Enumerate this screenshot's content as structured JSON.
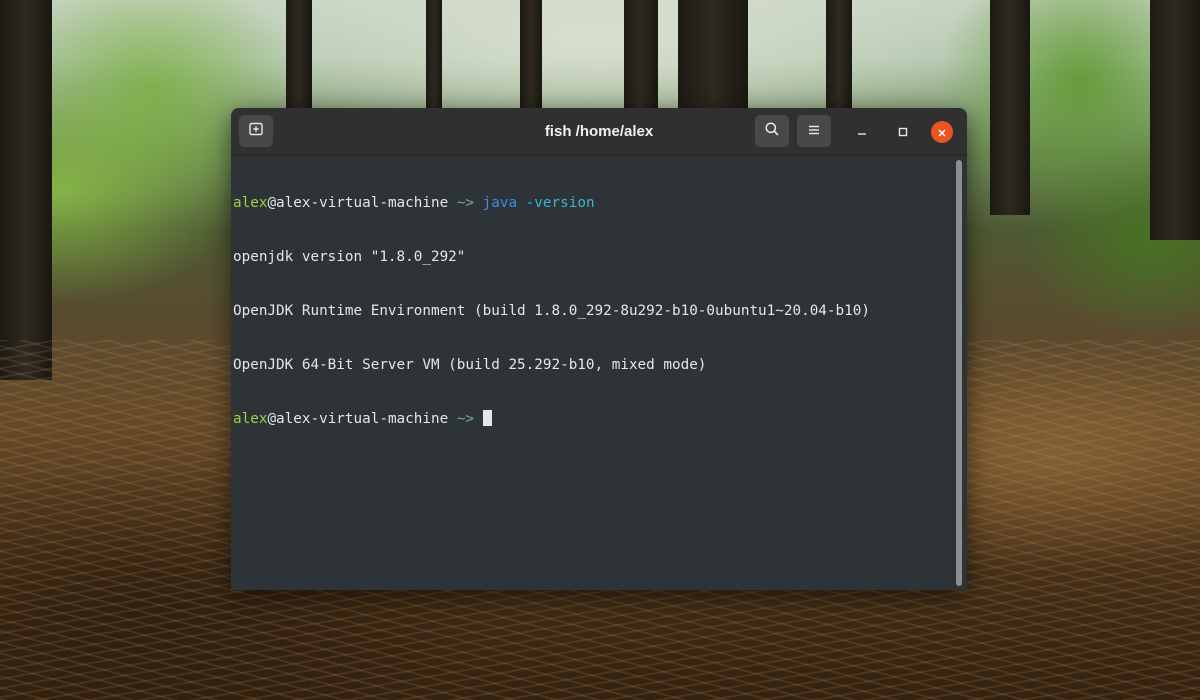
{
  "window": {
    "title": "fish /home/alex"
  },
  "icons": {
    "new_tab": "new-tab-icon",
    "search": "search-icon",
    "menu": "hamburger-menu-icon",
    "minimize": "minimize-icon",
    "maximize": "maximize-icon",
    "close": "close-icon"
  },
  "colors": {
    "close_button": "#e95420",
    "prompt_user": "#9ad34a",
    "prompt_path": "#6fa8a4",
    "command": "#3a8fe0",
    "argument": "#39b6d8",
    "terminal_background": "#2d3336"
  },
  "terminal": {
    "prompt": {
      "user": "alex",
      "host": "@alex-virtual-machine",
      "path": "~>"
    },
    "command": {
      "name": "java",
      "args": "-version"
    },
    "output": [
      "openjdk version \"1.8.0_292\"",
      "OpenJDK Runtime Environment (build 1.8.0_292-8u292-b10-0ubuntu1~20.04-b10)",
      "OpenJDK 64-Bit Server VM (build 25.292-b10, mixed mode)"
    ]
  }
}
